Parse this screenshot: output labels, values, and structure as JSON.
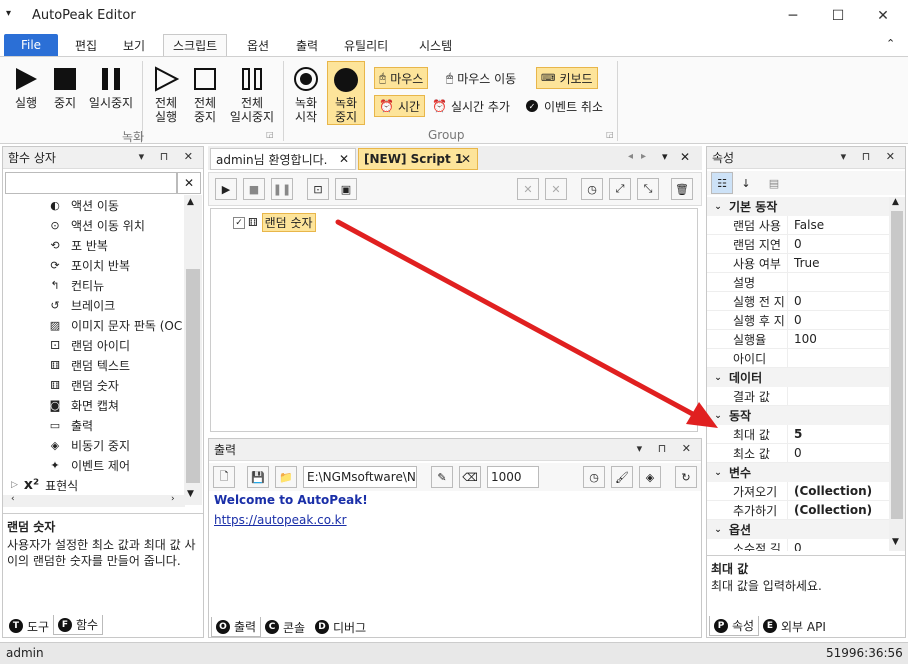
{
  "window": {
    "title": "AutoPeak Editor",
    "minimize": "─",
    "maximize": "☐",
    "close": "✕"
  },
  "menu_tabs": [
    "File",
    "편집",
    "보기",
    "스크립트",
    "옵션",
    "출력",
    "유틸리티",
    "시스템"
  ],
  "ribbon": {
    "record": {
      "play": "실행",
      "stop": "중지",
      "pause": "일시중지",
      "play_all": "전체\n실행",
      "stop_all": "전체\n중지",
      "pause_all": "전체\n일시중지",
      "group": "녹화"
    },
    "group2": {
      "rec_start": "녹화\n시작",
      "rec_stop": "녹화\n중지",
      "mouse": "마우스",
      "mouse_move": "마우스 이동",
      "keyboard": "키보드",
      "time": "시간",
      "realtime_add": "실시간 추가",
      "event_cancel": "이벤트 취소",
      "group": "Group"
    }
  },
  "function_panel": {
    "title": "함수 상자",
    "search_clear": "✕",
    "items": [
      {
        "label": "액션 이동",
        "icon": "action-move-icon"
      },
      {
        "label": "액션 이동 위치",
        "icon": "action-move-position-icon"
      },
      {
        "label": "포 반복",
        "icon": "for-loop-icon"
      },
      {
        "label": "포이치 반복",
        "icon": "foreach-loop-icon"
      },
      {
        "label": "컨티뉴",
        "icon": "continue-icon"
      },
      {
        "label": "브레이크",
        "icon": "break-icon"
      },
      {
        "label": "이미지 문자 판독 (OC",
        "icon": "ocr-icon"
      },
      {
        "label": "랜덤 아이디",
        "icon": "random-id-icon"
      },
      {
        "label": "랜덤 텍스트",
        "icon": "random-text-icon"
      },
      {
        "label": "랜덤 숫자",
        "icon": "random-number-icon"
      },
      {
        "label": "화면 캡쳐",
        "icon": "screen-capture-icon"
      },
      {
        "label": "출력",
        "icon": "print-icon"
      },
      {
        "label": "비동기 중지",
        "icon": "async-stop-icon"
      },
      {
        "label": "이벤트 제어",
        "icon": "event-control-icon"
      }
    ],
    "expression_item": "표현식",
    "desc_title": "랜덤 숫자",
    "desc_text": "사용자가 설정한 최소 값과 최대 값 사이의 랜덤한 숫자를 만들어 줍니다.",
    "tabs": {
      "tools": "도구",
      "functions": "함수"
    }
  },
  "editor": {
    "tabs": [
      {
        "label": "admin님 환영합니다."
      },
      {
        "label": "[NEW] Script 1"
      }
    ],
    "node_label": "랜덤 숫자"
  },
  "output": {
    "title": "출력",
    "path": "E:\\NGMsoftware\\NG",
    "count": "1000",
    "welcome": "Welcome to AutoPeak!",
    "link": "https://autopeak.co.kr",
    "tabs": {
      "output": "출력",
      "console": "콘솔",
      "debug": "디버그"
    }
  },
  "properties": {
    "title": "속성",
    "categories": [
      {
        "name": "기본 동작",
        "rows": [
          [
            "랜덤 사용",
            "False"
          ],
          [
            "랜덤 지연",
            "0"
          ],
          [
            "사용 여부",
            "True"
          ],
          [
            "설명",
            ""
          ],
          [
            "실행 전 지",
            "0"
          ],
          [
            "실행 후 지",
            "0"
          ],
          [
            "실행율",
            "100"
          ],
          [
            "아이디",
            ""
          ]
        ]
      },
      {
        "name": "데이터",
        "rows": [
          [
            "결과 값",
            ""
          ]
        ]
      },
      {
        "name": "동작",
        "rows": [
          [
            "최대 값",
            "5"
          ],
          [
            "최소 값",
            "0"
          ]
        ]
      },
      {
        "name": "변수",
        "rows": [
          [
            "가져오기",
            "(Collection)"
          ],
          [
            "추가하기",
            "(Collection)"
          ]
        ]
      },
      {
        "name": "옵션",
        "rows": [
          [
            "소수점 길",
            "0"
          ]
        ]
      }
    ],
    "desc_title": "최대 값",
    "desc_text": "최대 값을 입력하세요.",
    "tabs": {
      "props": "속성",
      "api": "외부 API"
    }
  },
  "status": {
    "user": "admin",
    "time": "51996:36:56"
  },
  "colors": {
    "accent": "#2b6fd6",
    "highlight": "#fde49a",
    "arrow": "#e02020"
  }
}
